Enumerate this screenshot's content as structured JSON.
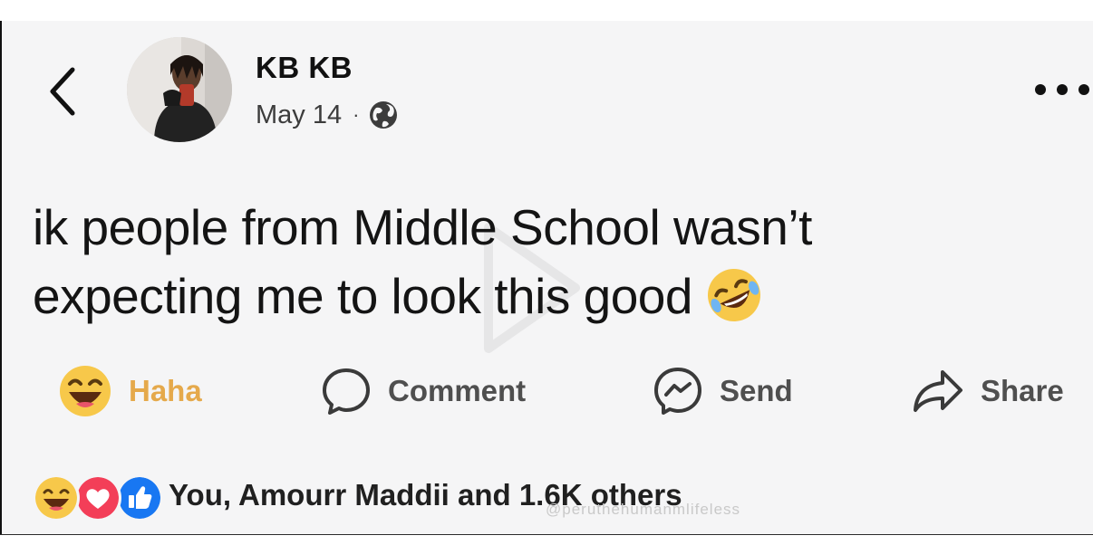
{
  "post": {
    "author": "KB KB",
    "date": "May 14",
    "separator": "·",
    "audience_icon": "globe-icon",
    "text_line1": "ik people from Middle School wasn’t",
    "text_line2": "expecting me to look this good",
    "emoji": "rolling-on-floor-laughing-icon"
  },
  "actions": {
    "haha": "Haha",
    "comment": "Comment",
    "send": "Send",
    "share": "Share"
  },
  "reactions": {
    "icons": [
      "haha-icon",
      "love-icon",
      "like-icon"
    ],
    "summary": "You, Amourr Maddii and 1.6K others"
  },
  "watermark": "@peruthehumanmlifeless",
  "colors": {
    "haha_label": "#e5a94b",
    "like_blue": "#1877f2",
    "love_red": "#f33e58",
    "emoji_yellow": "#f7c84a"
  }
}
